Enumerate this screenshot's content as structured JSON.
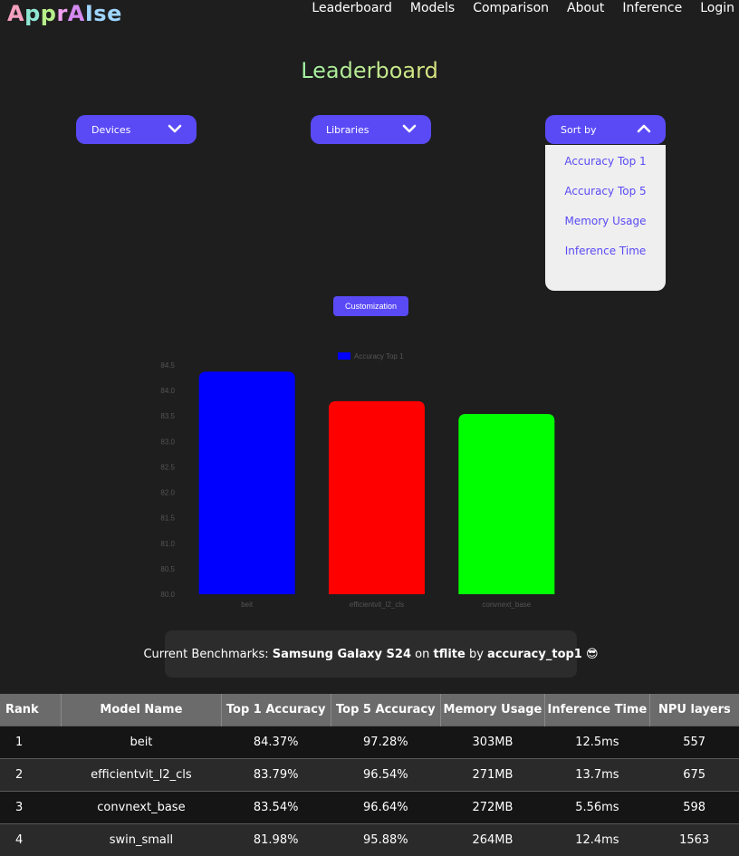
{
  "brand": {
    "letters": [
      "A",
      "p",
      "p",
      "r",
      "A",
      "Ise"
    ]
  },
  "nav": [
    "Leaderboard",
    "Models",
    "Comparison",
    "About",
    "Inference",
    "Login"
  ],
  "title": "Leaderboard",
  "dropdowns": {
    "devices": "Devices",
    "libraries": "Libraries",
    "sort_by": "Sort by"
  },
  "sort_options": [
    "Accuracy Top 1",
    "Accuracy Top 5",
    "Memory Usage",
    "Inference Time"
  ],
  "customization_button": "Customization",
  "chart_data": {
    "type": "bar",
    "categories": [
      "beit",
      "efficientvit_l2_cls",
      "convnext_base"
    ],
    "series": [
      {
        "name": "Accuracy Top 1",
        "values": [
          84.37,
          83.79,
          83.54
        ]
      }
    ],
    "bar_colors": [
      "#0000ff",
      "#ff0000",
      "#00ff00"
    ],
    "ylim": [
      80.0,
      84.5
    ],
    "yticks": [
      "80.0",
      "80.5",
      "81.0",
      "81.5",
      "82.0",
      "82.5",
      "83.0",
      "83.5",
      "84.0",
      "84.5"
    ],
    "legend_position": "top-center",
    "title": "",
    "xlabel": "",
    "ylabel": ""
  },
  "benchmark": {
    "prefix": "Current Benchmarks: ",
    "device": "Samsung Galaxy S24",
    "on": " on ",
    "library": "tflite",
    "by": " by ",
    "metric": "accuracy_top1",
    "emoji": "😎"
  },
  "table": {
    "headers": [
      "Rank",
      "Model Name",
      "Top 1 Accuracy",
      "Top 5 Accuracy",
      "Memory Usage",
      "Inference Time",
      "NPU layers"
    ],
    "rows": [
      [
        "1",
        "beit",
        "84.37%",
        "97.28%",
        "303MB",
        "12.5ms",
        "557"
      ],
      [
        "2",
        "efficientvit_l2_cls",
        "83.79%",
        "96.54%",
        "271MB",
        "13.7ms",
        "675"
      ],
      [
        "3",
        "convnext_base",
        "83.54%",
        "96.64%",
        "272MB",
        "5.56ms",
        "598"
      ],
      [
        "4",
        "swin_small",
        "81.98%",
        "95.88%",
        "264MB",
        "12.4ms",
        "1563"
      ]
    ]
  }
}
